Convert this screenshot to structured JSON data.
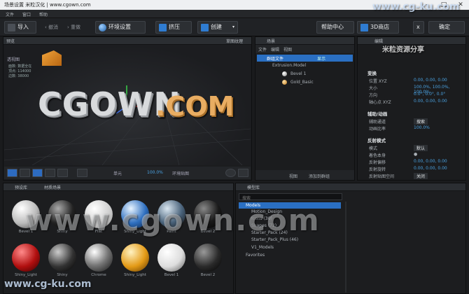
{
  "title_bar": {
    "title": "场景设置  米粒汉化 | www.cgown.com",
    "minimize": "–",
    "maximize": "□",
    "close": "✕"
  },
  "menu": {
    "items": [
      "文件",
      "窗口",
      "帮助"
    ]
  },
  "toolbar": {
    "import": "导入",
    "undo": "撤消",
    "redo": "重做",
    "environment": "环境设置",
    "extrude": "挤压",
    "create": "创建",
    "help_center": "帮助中心",
    "store": "3D商店",
    "close_x": "x",
    "ok": "确定"
  },
  "preview": {
    "tab": "预览",
    "top_right_label": "草图纹理",
    "mode_select": "透视图",
    "stats": {
      "faces_label": "面数",
      "faces_value": "数据全在",
      "vertices_label": "顶点",
      "vertices_value": "114000",
      "edges_label": "边数",
      "edges_value": "38000"
    },
    "scene_text": "CGOWN",
    "scene_text_suffix": ".COM",
    "bottom": {
      "single_select": "单元",
      "zoom": "100.0%",
      "env_render": "环境贴图"
    }
  },
  "scene": {
    "tab": "场景",
    "menu": [
      "文件",
      "编辑",
      "视图"
    ],
    "items": [
      {
        "label": "群组文件",
        "badge": "显示"
      },
      {
        "label": "Extrusion.Model"
      },
      {
        "label": "Bevel 1"
      },
      {
        "label": "Gold_Basic"
      }
    ],
    "footer_view": "视图",
    "footer_add": "添加到群组"
  },
  "editor": {
    "tab": "编辑",
    "transform_title": "变换",
    "position_label": "位置 XYZ",
    "position_value": "0.00,  0.00,  0.00",
    "size_label": "大小",
    "size_value": "100.0%,  100.0%,  100.0%",
    "direction_label": "方向",
    "direction_value": "0.0°,  0.0°,  0.0°",
    "pivot_label": "轴心点 XYZ",
    "pivot_value": "0.00,  0.00,  0.00",
    "assist_title": "辅助/动画",
    "assist_label": "辅助通道",
    "assist_value": "搜索",
    "anim_label": "动画比率",
    "anim_value": "100.0%",
    "reflect_title": "反射模式",
    "mode_label": "模式",
    "mode_value": "默认",
    "color_label": "着色本身",
    "color_value": "●",
    "reflect_offset_label": "反射偏移",
    "reflect_offset_value": "0.00,  0.00,  0.00",
    "reflect_rot_label": "反射旋转",
    "reflect_rot_value": "0.00,  0.00,  0.00",
    "reflect_ref_label": "反射贴图空间",
    "reflect_ref_value": "关闭"
  },
  "library": {
    "tabs": [
      "预设库",
      "材质场景"
    ],
    "materials": [
      {
        "name": "Bevel 1"
      },
      {
        "name": "Shiny"
      },
      {
        "name": "Flat"
      },
      {
        "name": "Shiny_Light"
      },
      {
        "name": "Paint"
      },
      {
        "name": "Bevel 2"
      },
      {
        "name": "Shiny_Light"
      },
      {
        "name": "Shiny"
      },
      {
        "name": "Chrome"
      },
      {
        "name": "Shiny_Light"
      },
      {
        "name": "Bevel 1"
      },
      {
        "name": "Bevel 2"
      }
    ]
  },
  "models": {
    "tab": "模型库",
    "search_placeholder": "搜索",
    "tree": [
      {
        "label": "Models",
        "level": 0
      },
      {
        "label": "Motion_Design",
        "level": 1
      },
      {
        "label": "Icons (30)",
        "level": 1
      },
      {
        "label": "Shapes (72)",
        "level": 1
      },
      {
        "label": "Starter_Pack (24)",
        "level": 1
      },
      {
        "label": "Starter_Pack_Plus (46)",
        "level": 1
      },
      {
        "label": "V1_Models",
        "level": 1
      },
      {
        "label": "Favorites",
        "level": 0
      }
    ]
  },
  "watermarks": {
    "top": "www.cg-ku.com",
    "mid": "www.cgown.com",
    "bottom": "www.cg-ku.com",
    "logo_cn": "米粒资源分享"
  },
  "colors": {
    "accent": "#3a8fe0",
    "gold": "#e9ad62",
    "panel": "#1b1c1e"
  }
}
